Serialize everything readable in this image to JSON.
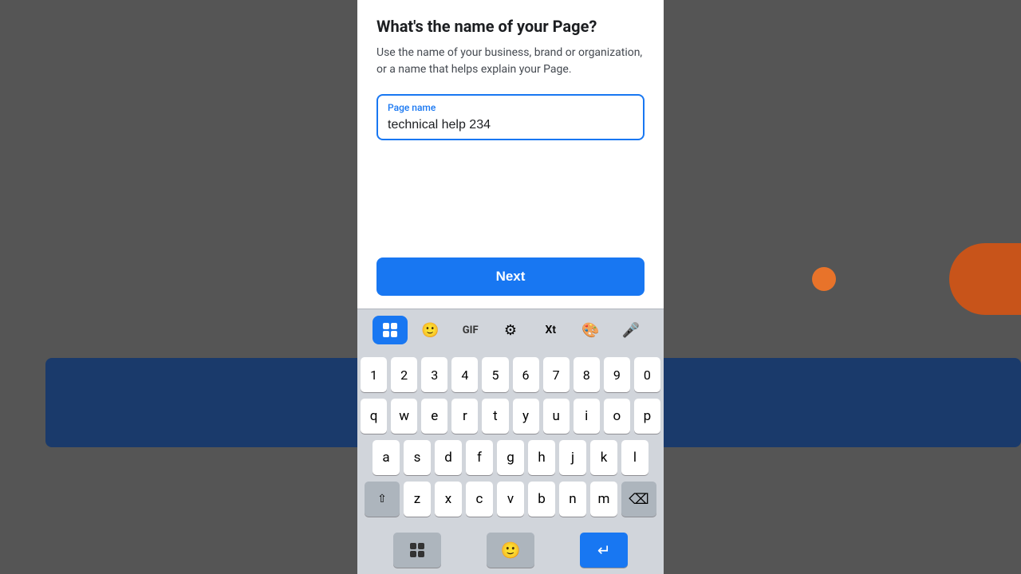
{
  "background": {
    "left_color": "#555555",
    "right_color": "#555555",
    "blue_bar_color": "#1a3a6b"
  },
  "modal": {
    "title": "What's the name of your Page?",
    "description": "Use the name of your business, brand or organization, or a name that helps explain your Page.",
    "input": {
      "label": "Page name",
      "value": "technical help 234",
      "placeholder": "Page name"
    },
    "next_button_label": "Next"
  },
  "keyboard": {
    "toolbar": {
      "apps_icon": "⊞",
      "emoji_icon": "🙂",
      "gif_label": "GIF",
      "settings_icon": "⚙",
      "translate_icon": "Xt",
      "palette_icon": "🎨",
      "mic_icon": "🎤"
    },
    "rows": {
      "numbers": [
        "1",
        "2",
        "3",
        "4",
        "5",
        "6",
        "7",
        "8",
        "9",
        "0"
      ],
      "row1": [
        "q",
        "w",
        "e",
        "r",
        "t",
        "y",
        "u",
        "i",
        "o",
        "p"
      ],
      "row2": [
        "a",
        "s",
        "d",
        "f",
        "g",
        "h",
        "j",
        "k",
        "l"
      ],
      "row3": [
        "z",
        "x",
        "c",
        "v",
        "b",
        "n",
        "m"
      ]
    }
  }
}
